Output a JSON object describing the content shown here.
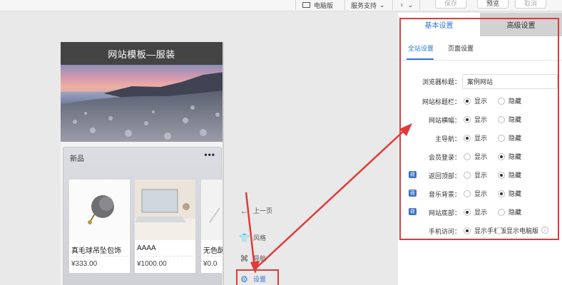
{
  "toolbar": {
    "desktop_label": "电脑版",
    "service_label": "服务支持",
    "save_label": "保存",
    "preview_label": "预览",
    "cancel_label": "取消"
  },
  "phone": {
    "title": "网站模板—服装",
    "section_title": "新品",
    "more_label": "•••",
    "products": [
      {
        "name": "真毛球吊坠包饰",
        "price": "¥333.00"
      },
      {
        "name": "AAAA",
        "price": "¥1000.00"
      },
      {
        "name": "无色酥",
        "price": "¥0.0"
      }
    ]
  },
  "side_menu": {
    "prev": "上一页",
    "style": "风格",
    "nav": "导航",
    "settings": "设置"
  },
  "panel": {
    "tabs": [
      "基本设置",
      "高级设置"
    ],
    "subtabs": [
      "全站设置",
      "页面设置"
    ],
    "browser_title_label": "浏览器标题：",
    "browser_title_value": "案例网站",
    "show": "显示",
    "hide": "隐藏",
    "vip_badge": "荷",
    "rows": {
      "title_bar": "网站标题栏：",
      "banner": "网站横幅：",
      "main_nav": "主导航：",
      "member_login": "会员登录：",
      "back_top": "返回顶部：",
      "music_bg": "音乐背景：",
      "footer": "网站底部：",
      "mobile_visit": "手机访问："
    },
    "show_mobile": "显示手机版",
    "show_desktop": "显示电脑版",
    "info": "i"
  },
  "colors": {
    "accent": "#2f7ad6",
    "annotation_red": "#e03a3a",
    "phone_header": "#444444"
  }
}
